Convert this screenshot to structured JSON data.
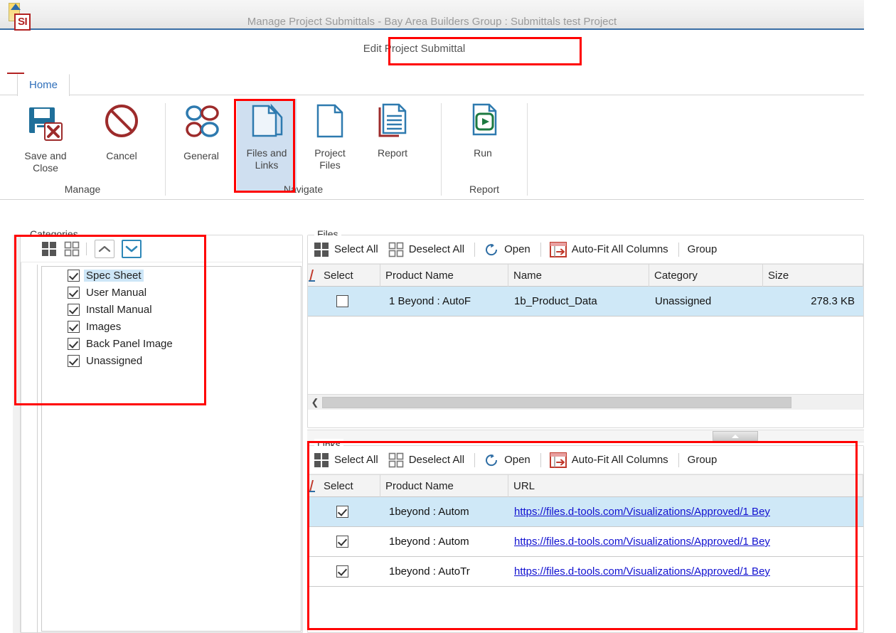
{
  "window": {
    "title": "Manage Project Submittals - Bay Area Builders Group : Submittals test Project",
    "document_title": "Edit Project Submittal",
    "app_logo_text": "SI"
  },
  "ribbon": {
    "tabs": [
      {
        "label": "Home",
        "active": true
      }
    ],
    "groups": [
      {
        "name": "Manage",
        "label": "Manage",
        "buttons": [
          {
            "id": "save-and-close",
            "label": "Save and\nClose",
            "icon": "save-icon",
            "selected": false
          },
          {
            "id": "cancel",
            "label": "Cancel",
            "icon": "cancel-icon",
            "selected": false
          }
        ]
      },
      {
        "name": "Navigate",
        "label": "Navigate",
        "buttons": [
          {
            "id": "general",
            "label": "General",
            "icon": "general-circles-icon",
            "selected": false
          },
          {
            "id": "files-and-links",
            "label": "Files and\nLinks",
            "icon": "files-and-links-icon",
            "selected": true
          },
          {
            "id": "project-files",
            "label": "Project\nFiles",
            "icon": "project-files-icon",
            "selected": false
          },
          {
            "id": "report",
            "label": "Report",
            "icon": "report-icon",
            "selected": false
          }
        ]
      },
      {
        "name": "Report",
        "label": "Report",
        "buttons": [
          {
            "id": "run",
            "label": "Run",
            "icon": "run-report-icon",
            "selected": false
          }
        ]
      }
    ]
  },
  "categories": {
    "panel_title": "Categories",
    "toolbar": [
      {
        "id": "select-all",
        "icon": "select-all-icon",
        "tooltip": "Select All"
      },
      {
        "id": "deselect-all",
        "icon": "deselect-all-icon",
        "tooltip": "Deselect All"
      },
      {
        "id": "collapse-all",
        "icon": "chevron-up-icon",
        "tooltip": "Collapse All",
        "active": false
      },
      {
        "id": "expand-all",
        "icon": "chevron-down-icon",
        "tooltip": "Expand All",
        "active": true
      }
    ],
    "items": [
      {
        "label": "Spec Sheet",
        "checked": true,
        "selected": true
      },
      {
        "label": "User Manual",
        "checked": true,
        "selected": false
      },
      {
        "label": "Install Manual",
        "checked": true,
        "selected": false
      },
      {
        "label": "Images",
        "checked": true,
        "selected": false
      },
      {
        "label": "Back Panel Image",
        "checked": true,
        "selected": false
      },
      {
        "label": "Unassigned",
        "checked": true,
        "selected": false
      }
    ]
  },
  "files": {
    "panel_title": "Files",
    "toolbar": [
      {
        "id": "select-all",
        "label": "Select All",
        "icon": "select-all-icon"
      },
      {
        "id": "deselect-all",
        "label": "Deselect All",
        "icon": "deselect-all-icon"
      },
      {
        "id": "open",
        "label": "Open",
        "icon": "open-refresh-icon"
      },
      {
        "id": "auto-fit-all-columns",
        "label": "Auto-Fit All Columns",
        "icon": "auto-fit-icon"
      },
      {
        "id": "group",
        "label": "Group",
        "icon": "group-icon"
      }
    ],
    "columns": [
      "Select",
      "Product Name",
      "Name",
      "Category",
      "Size"
    ],
    "rows": [
      {
        "selected_row": true,
        "checked": false,
        "product_name": "1 Beyond : AutoF",
        "name": "1b_Product_Data",
        "category": "Unassigned",
        "size": "278.3 KB"
      }
    ]
  },
  "links": {
    "panel_title": "Links",
    "toolbar": [
      {
        "id": "select-all",
        "label": "Select All",
        "icon": "select-all-icon"
      },
      {
        "id": "deselect-all",
        "label": "Deselect All",
        "icon": "deselect-all-icon"
      },
      {
        "id": "open",
        "label": "Open",
        "icon": "open-refresh-icon"
      },
      {
        "id": "auto-fit-all-columns",
        "label": "Auto-Fit All Columns",
        "icon": "auto-fit-icon"
      },
      {
        "id": "group",
        "label": "Group",
        "icon": "group-icon"
      }
    ],
    "columns": [
      "Select",
      "Product Name",
      "URL"
    ],
    "rows": [
      {
        "selected_row": true,
        "checked": true,
        "product_name": "1beyond : Autom",
        "url": "https://files.d-tools.com/Visualizations/Approved/1 Bey"
      },
      {
        "selected_row": false,
        "checked": true,
        "product_name": "1beyond : Autom",
        "url": "https://files.d-tools.com/Visualizations/Approved/1 Bey"
      },
      {
        "selected_row": false,
        "checked": true,
        "product_name": "1beyond : AutoTr",
        "url": "https://files.d-tools.com/Visualizations/Approved/1 Bey"
      }
    ]
  },
  "annotations": {
    "color": "#ff0000",
    "boxes": [
      {
        "id": "anno-title",
        "target": "document-title"
      },
      {
        "id": "anno-filesandlinks",
        "target": "files-and-links-ribbon-button"
      },
      {
        "id": "anno-categories",
        "target": "categories-panel"
      },
      {
        "id": "anno-links",
        "target": "links-panel"
      }
    ]
  },
  "colors": {
    "accent_blue": "#2f6fba",
    "selection_blue": "#cfe8f7",
    "ribbon_selected": "#cfdff0",
    "link_blue": "#1010d0",
    "annotation_red": "#ff0000",
    "logo_red": "#b22222"
  }
}
